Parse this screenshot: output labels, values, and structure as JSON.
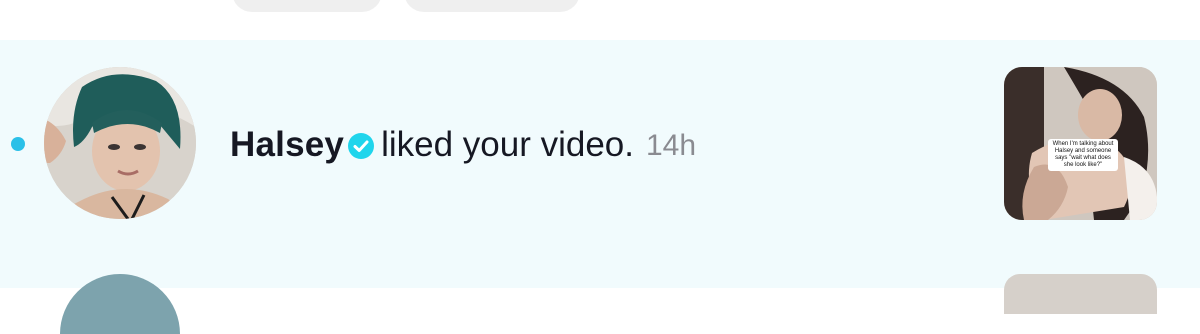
{
  "notification": {
    "unread": true,
    "user_name": "Halsey",
    "verified": true,
    "action_text": " liked your video.",
    "timestamp": "14h",
    "thumbnail_caption": "When I'm talking about Halsey and someone says \"wait what does she look like?\""
  },
  "icons": {
    "verified": "verified-badge-icon",
    "unread": "unread-dot-icon"
  },
  "colors": {
    "accent": "#2bc0e8",
    "row_background": "#f1fbfd",
    "text_primary": "#161823",
    "text_secondary": "#8a8b91"
  }
}
